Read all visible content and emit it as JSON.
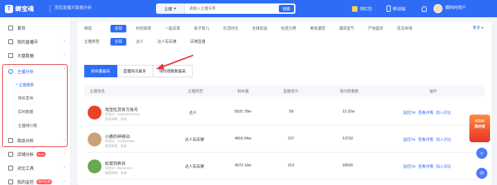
{
  "header": {
    "brand": "蝉宝魂",
    "slogan": "淘宝直播大数据分析",
    "search": {
      "category": "主播",
      "placeholder": "请输入主播名称",
      "button": "搜索"
    },
    "items": [
      "领红包",
      "移动端"
    ],
    "username": "蝉妈妈用户"
  },
  "sidebar": {
    "items": [
      {
        "label": "首页"
      },
      {
        "label": "我的直播号"
      },
      {
        "label": "大盘数据"
      },
      {
        "label": "主播分析"
      },
      {
        "label": "商品分析"
      },
      {
        "label": "店铺分析",
        "badge": "New"
      },
      {
        "label": "对比工具"
      },
      {
        "label": "我的监控",
        "badge": "限时免费"
      }
    ],
    "subitems": [
      "主播搜索",
      "排名查询",
      "实时数据",
      "主播排行榜"
    ]
  },
  "filters": {
    "row1_label": "频道",
    "row1": [
      "全部",
      "时尚穿搭",
      "一起买菜",
      "亲子育儿",
      "乐活时光",
      "全球优选",
      "吃货力荐",
      "美妆潮范",
      "潮流宝气",
      "产地直供",
      "花鸟市场"
    ],
    "more": "更多",
    "row2_label": "主播类型",
    "row2": [
      "全部",
      "达人",
      "达人有店铺",
      "店铺直播"
    ]
  },
  "tabs": [
    "粉丝量最高",
    "直播场次最多",
    "场均观看数最高"
  ],
  "table": {
    "headers": [
      "主播信息",
      "主播类型",
      "粉丝量",
      "直播场次",
      "场均观看数",
      "操作"
    ],
    "ops": [
      "监控TA",
      "查看详情",
      "加入对比"
    ],
    "rows": [
      {
        "name": "淘宝吃货官方账号",
        "id": "淘宝ID：2206459752181",
        "tag": "频道领域：美食",
        "type": "达人",
        "fans": "5531.78w",
        "sessions": "59",
        "avg": "12.32w",
        "color": "#e8412c"
      },
      {
        "name": "小鹿的神爸站",
        "id": "淘宝ID：2219697880",
        "tag": "频道领域：美食",
        "type": "达人有店铺",
        "fans": "4816.94w",
        "sessions": "137",
        "avg": "13732",
        "color": "#c9a27a"
      },
      {
        "name": "松鼠饲养员",
        "id": "淘宝ID：866424321",
        "tag": "频道领域：美食",
        "type": "达人有店铺",
        "fans": "4072.18w",
        "sessions": "212",
        "avg": "18026",
        "color": "#6aa84f"
      }
    ]
  },
  "promo": {
    "line1": "¥2500",
    "line2": "限时领"
  }
}
